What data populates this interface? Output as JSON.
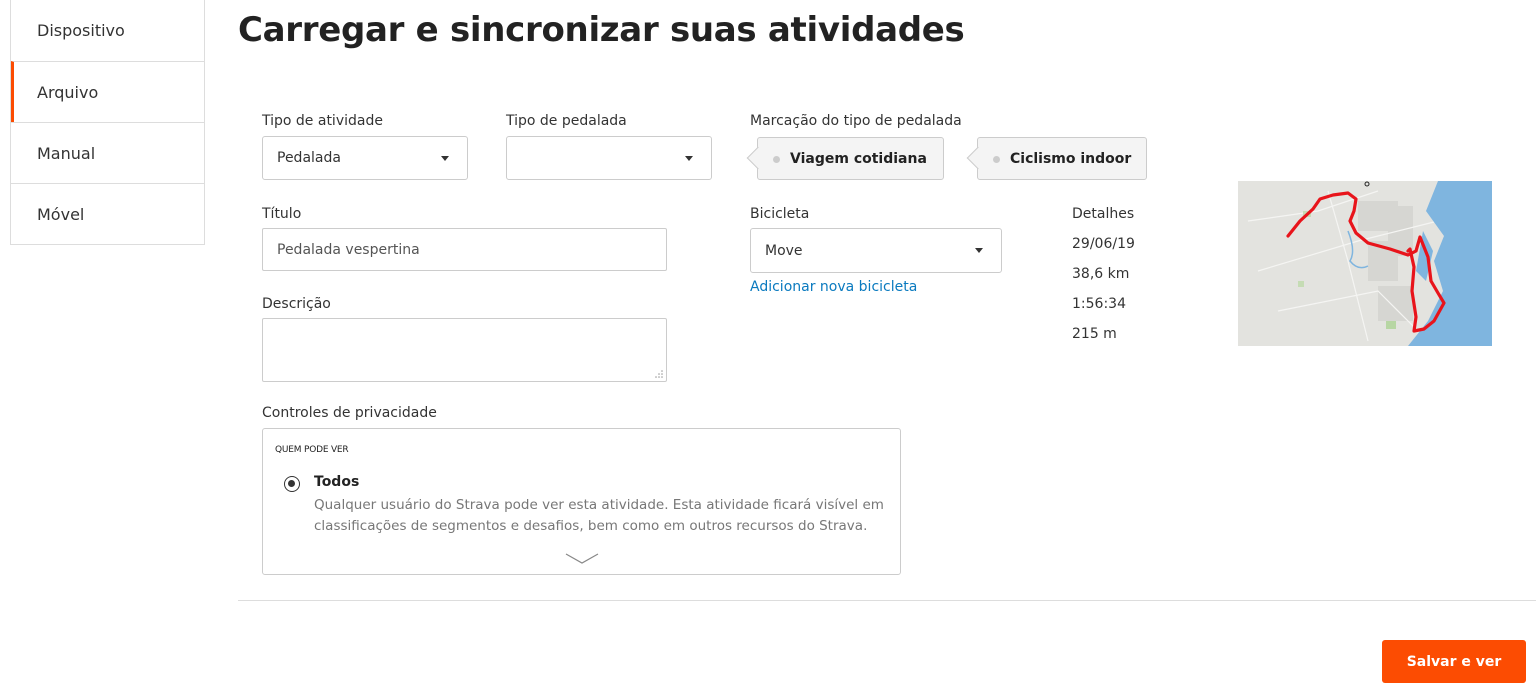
{
  "sidebar": {
    "items": [
      {
        "label": "Dispositivo",
        "active": false
      },
      {
        "label": "Arquivo",
        "active": true
      },
      {
        "label": "Manual",
        "active": false
      },
      {
        "label": "Móvel",
        "active": false
      }
    ]
  },
  "page": {
    "title": "Carregar e sincronizar suas atividades"
  },
  "form": {
    "activity_type": {
      "label": "Tipo de atividade",
      "value": "Pedalada"
    },
    "ride_type": {
      "label": "Tipo de pedalada",
      "value": ""
    },
    "ride_tag": {
      "label": "Marcação do tipo de pedalada",
      "options": [
        "Viagem cotidiana",
        "Ciclismo indoor"
      ]
    },
    "title": {
      "label": "Título",
      "value": "Pedalada vespertina"
    },
    "description": {
      "label": "Descrição",
      "value": ""
    },
    "bike": {
      "label": "Bicicleta",
      "value": "Move",
      "add_link": "Adicionar nova bicicleta"
    },
    "details": {
      "label": "Detalhes",
      "date": "29/06/19",
      "distance": "38,6 km",
      "time": "1:56:34",
      "elevation": "215 m"
    },
    "privacy": {
      "label": "Controles de privacidade",
      "section_header": "QUEM PODE VER",
      "selected_option": "Todos",
      "selected_description": "Qualquer usuário do Strava pode ver esta atividade. Esta atividade ficará visível em classificações de segmentos e desafios, bem como em outros recursos do Strava."
    }
  },
  "actions": {
    "save_label": "Salvar e ver"
  },
  "colors": {
    "accent": "#fc4c02",
    "link": "#0a7abf",
    "route": "#e8141b"
  },
  "icons": {
    "dropdown": "caret-down-icon",
    "expand": "chevron-down-icon"
  }
}
